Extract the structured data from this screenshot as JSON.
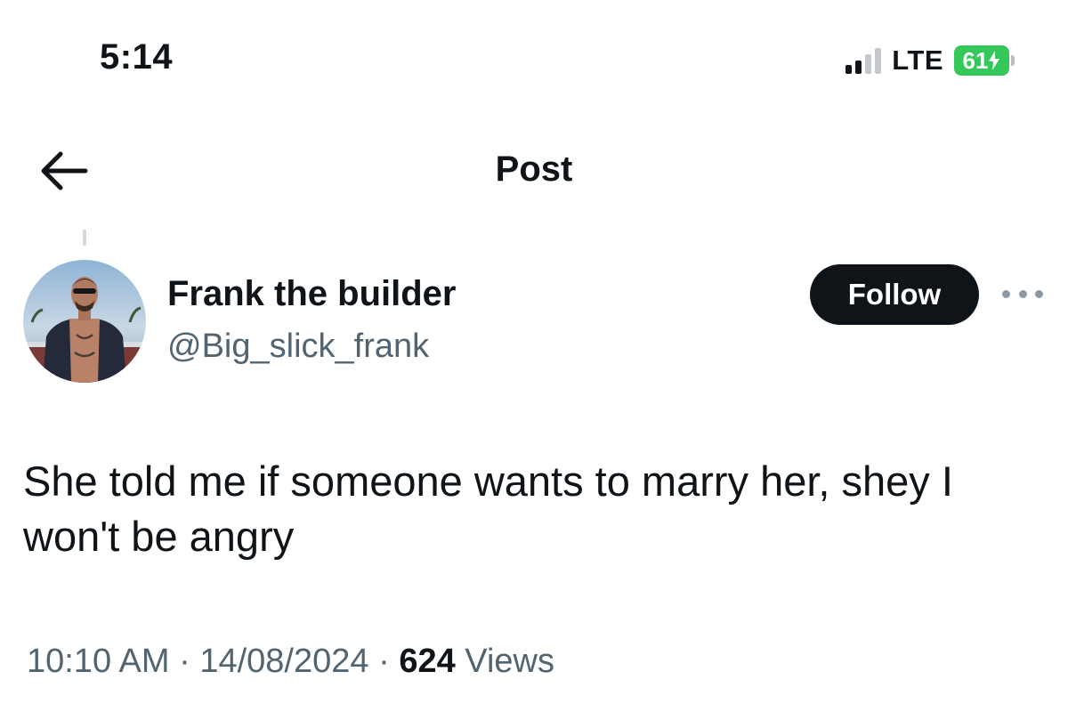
{
  "status_bar": {
    "time": "5:14",
    "network": "LTE",
    "battery": "61",
    "signal_bars_active": 2,
    "signal_bars_total": 4
  },
  "header": {
    "title": "Post",
    "back_icon": "arrow-left-icon"
  },
  "author": {
    "name": "Frank the builder",
    "handle": "@Big_slick_frank",
    "follow_label": "Follow",
    "more_icon": "more-horizontal-icon"
  },
  "post": {
    "text": "She told me if someone wants to marry her, shey I won't be angry",
    "time": "10:10 AM",
    "date": "14/08/2024",
    "separator": "·",
    "views_count": "624",
    "views_label": "Views"
  },
  "colors": {
    "text_primary": "#0f1419",
    "text_secondary": "#536471",
    "battery_green": "#34c759",
    "follow_bg": "#0f1419"
  }
}
